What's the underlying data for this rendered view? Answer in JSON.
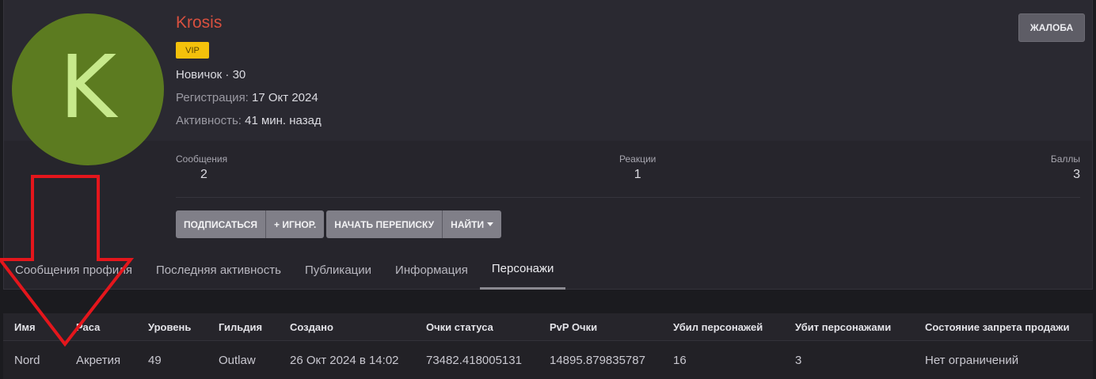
{
  "profile": {
    "avatar_letter": "K",
    "username": "Krosis",
    "badge": "VIP",
    "rank": "Новичок · 30",
    "registration_label": "Регистрация:",
    "registration_value": "17 Окт 2024",
    "activity_label": "Активность:",
    "activity_value": "41 мин. назад",
    "report_label": "ЖАЛОБА"
  },
  "stats": {
    "messages_label": "Сообщения",
    "messages_value": "2",
    "reactions_label": "Реакции",
    "reactions_value": "1",
    "points_label": "Баллы",
    "points_value": "3"
  },
  "actions": {
    "follow": "ПОДПИСАТЬСЯ",
    "ignore": "+ ИГНОР.",
    "start_conversation": "НАЧАТЬ ПЕРЕПИСКУ",
    "find": "НАЙТИ"
  },
  "tabs": [
    {
      "label": "Сообщения профиля"
    },
    {
      "label": "Последняя активность"
    },
    {
      "label": "Публикации"
    },
    {
      "label": "Информация"
    },
    {
      "label": "Персонажи"
    }
  ],
  "active_tab": "Персонажи",
  "characters": {
    "columns": [
      "Имя",
      "Раса",
      "Уровень",
      "Гильдия",
      "Создано",
      "Очки статуса",
      "PvP Очки",
      "Убил персонажей",
      "Убит персонажами",
      "Состояние запрета продажи"
    ],
    "rows": [
      [
        "Nord",
        "Акретия",
        "49",
        "Outlaw",
        "26 Окт 2024 в 14:02",
        "73482.418005131",
        "14895.879835787",
        "16",
        "3",
        "Нет ограничений"
      ]
    ]
  },
  "colors": {
    "username": "#d9503f",
    "avatar_bg": "#5c7b20",
    "badge_bg": "#f4c10b",
    "annotation_arrow": "#e4161c"
  },
  "icons": [
    "chevron-down-icon",
    "annotation-arrow-icon"
  ]
}
